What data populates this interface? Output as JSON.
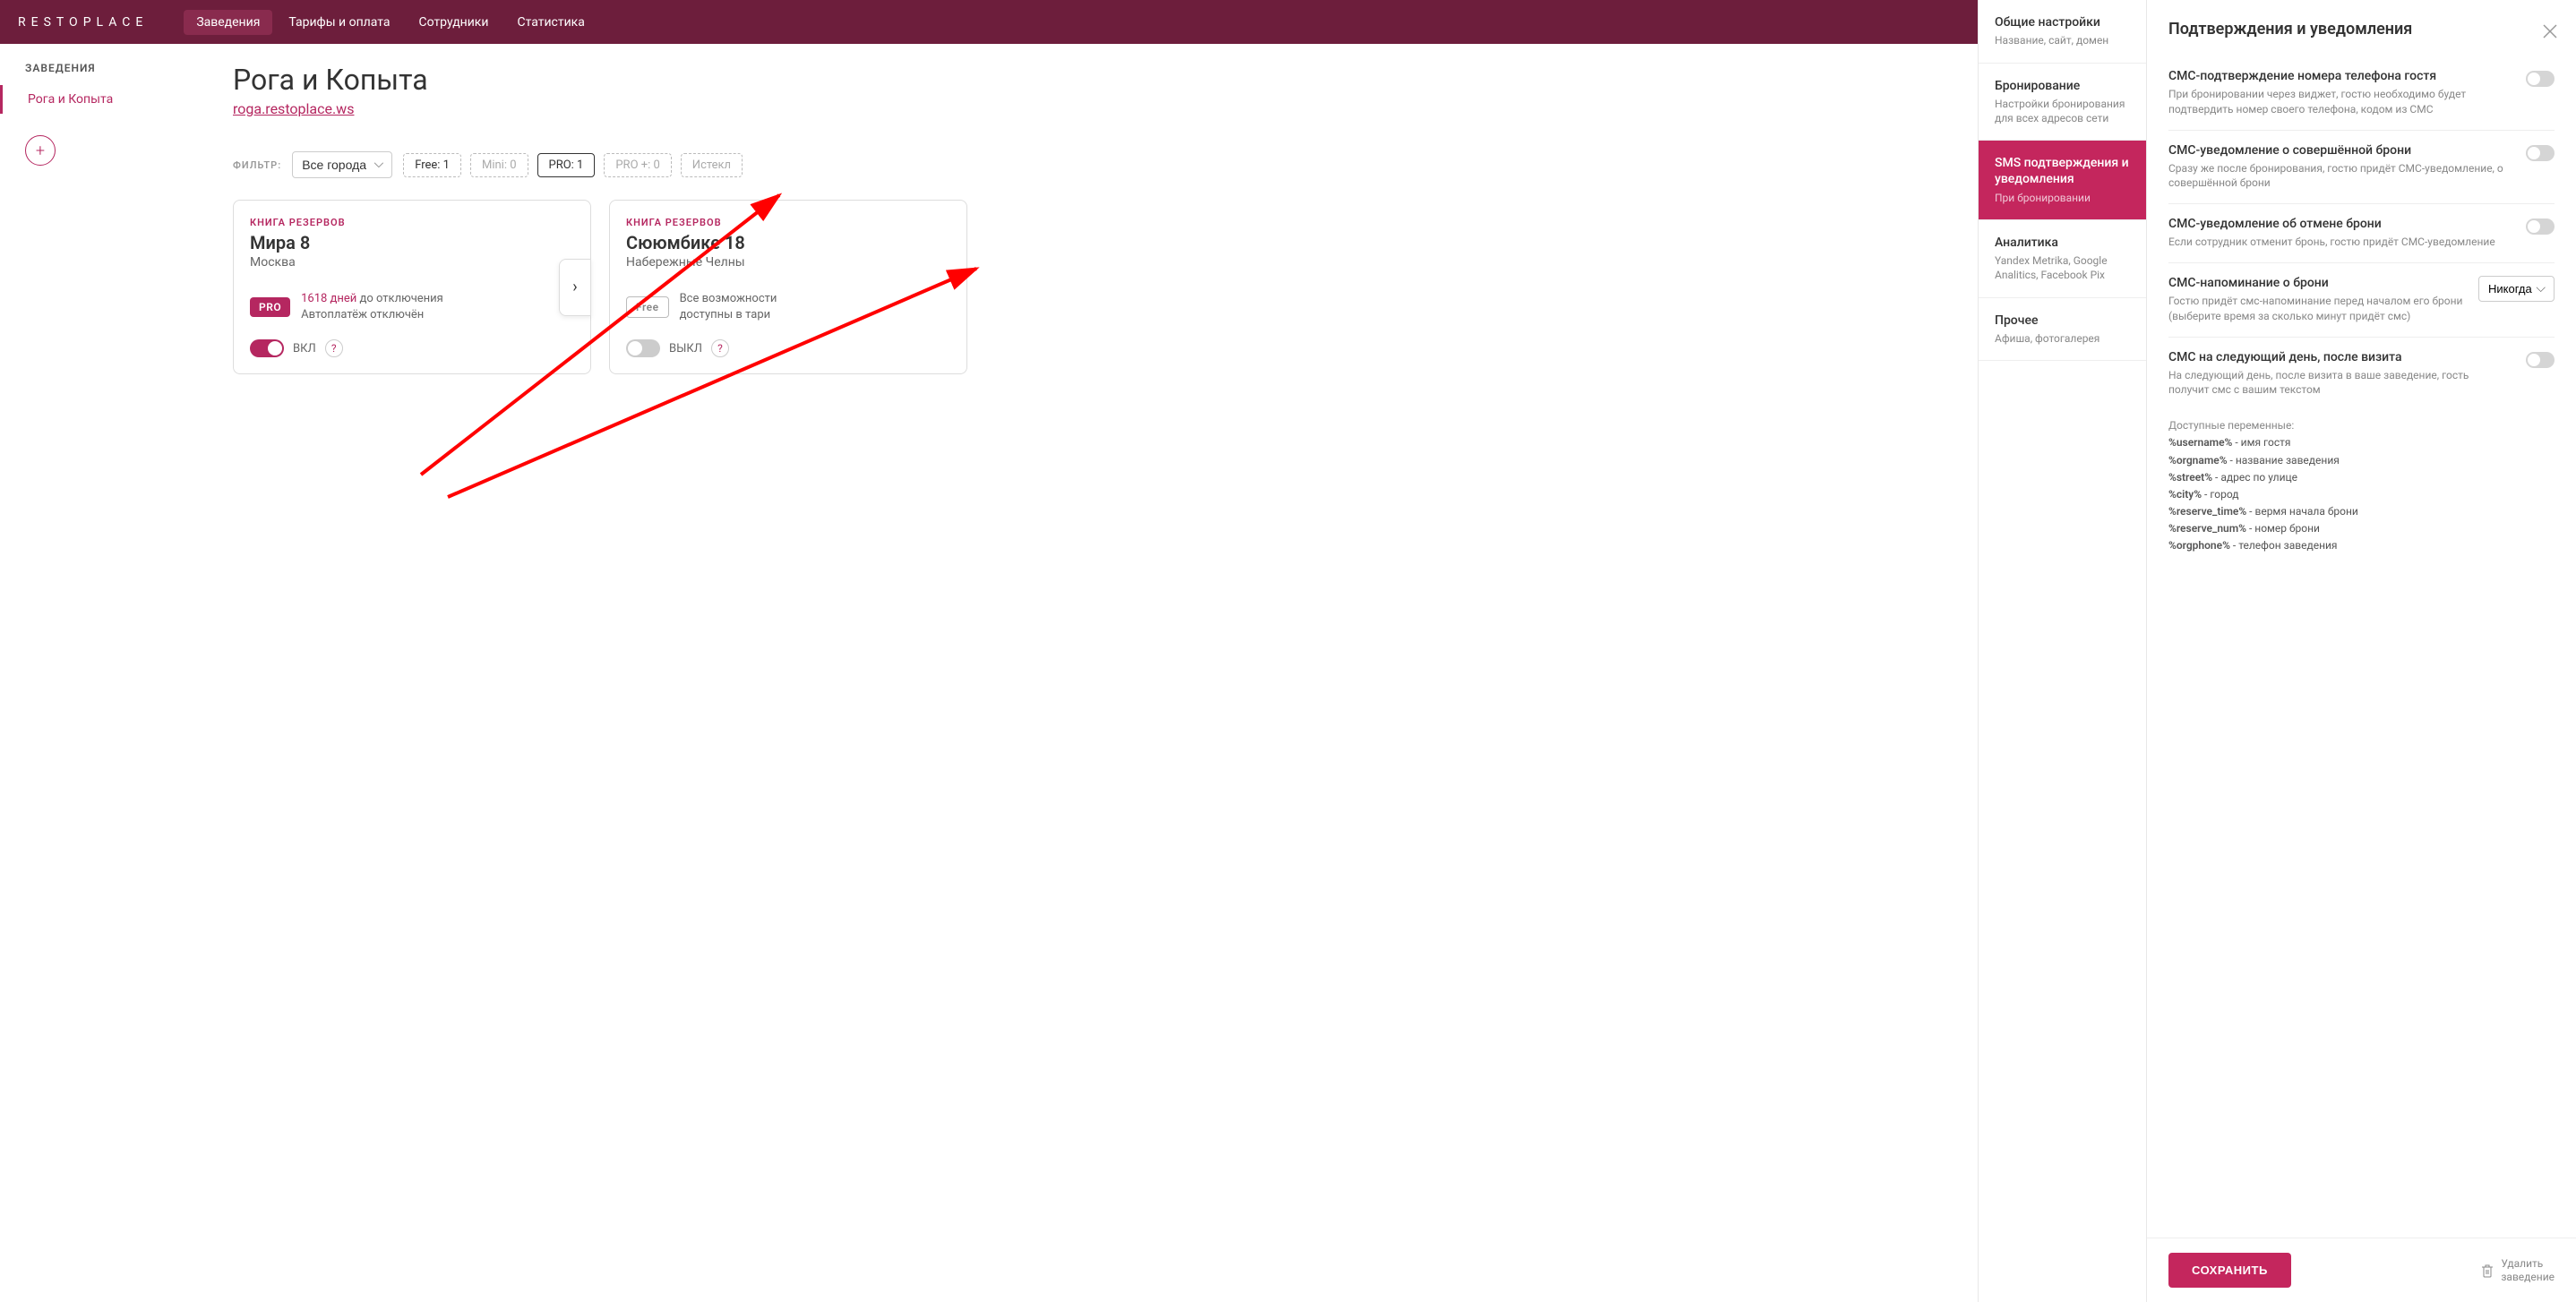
{
  "logo": "RESTOPLACE",
  "nav": {
    "items": [
      "Заведения",
      "Тарифы и оплата",
      "Сотрудники",
      "Статистика"
    ],
    "activeIndex": 0
  },
  "sidebar": {
    "title": "ЗАВЕДЕНИЯ",
    "items": [
      "Рога и Копыта"
    ]
  },
  "page": {
    "title": "Рога и Копыта",
    "url": "roga.restoplace.ws"
  },
  "filter": {
    "label": "ФИЛЬТР:",
    "city": "Все города",
    "tags": [
      {
        "label": "Free: 1",
        "style": "active"
      },
      {
        "label": "Mini: 0",
        "style": ""
      },
      {
        "label": "PRO: 1",
        "style": "solid"
      },
      {
        "label": "PRO +: 0",
        "style": ""
      },
      {
        "label": "Истекл",
        "style": ""
      }
    ]
  },
  "cards": [
    {
      "type": "КНИГА РЕЗЕРВОВ",
      "title": "Мира 8",
      "city": "Москва",
      "badge": "PRO",
      "badgeClass": "",
      "line1a": "1618 дней",
      "line1b": " до отключения",
      "line2": "Автоплатёж отключён",
      "toggleOn": true,
      "toggleLabel": "ВКЛ",
      "hasArrow": true
    },
    {
      "type": "КНИГА РЕЗЕРВОВ",
      "title": "Сююмбике 18",
      "city": "Набережные Челны",
      "badge": "Free",
      "badgeClass": "free",
      "line1a": "",
      "line1b": "Все возможности",
      "line2": "доступны в тари",
      "toggleOn": false,
      "toggleLabel": "ВЫКЛ",
      "hasArrow": false
    }
  ],
  "midPanel": {
    "items": [
      {
        "title": "Общие настройки",
        "sub": "Название, сайт, домен",
        "active": false
      },
      {
        "title": "Бронирование",
        "sub": "Настройки бронирования для всех адресов сети",
        "active": false
      },
      {
        "title": "SMS подтверждения и уведомления",
        "sub": "При бронировании",
        "active": true
      },
      {
        "title": "Аналитика",
        "sub": "Yandex Metrika, Google Analitics, Facebook Pix",
        "active": false
      },
      {
        "title": "Прочее",
        "sub": "Афиша, фотогалерея",
        "active": false
      }
    ]
  },
  "rightPanel": {
    "title": "Подтверждения и уведомления",
    "settings": [
      {
        "title": "СМС-подтверждение номера телефона гостя",
        "desc": "При бронировании через виджет, гостю необходимо будет подтвердить номер своего телефона, кодом из СМС",
        "control": "toggle"
      },
      {
        "title": "СМС-уведомление о совершённой брони",
        "desc": "Сразу же после бронирования, гостю придёт СМС-уведомление, о совершённой брони",
        "control": "toggle"
      },
      {
        "title": "СМС-уведомление об отмене брони",
        "desc": "Если сотрудник отменит бронь, гостю придёт СМС-уведомление",
        "control": "toggle"
      },
      {
        "title": "СМС-напоминание о брони",
        "desc": "Гостю придёт смс-напоминание перед началом его брони (выберите время за сколько минут придёт смс)",
        "control": "select",
        "selectValue": "Никогда"
      },
      {
        "title": "СМС на следующий день, после визита",
        "desc": "На следующий день, после визита в ваше заведение, гость получит смс с вашим текстом",
        "control": "toggle"
      }
    ],
    "varsHeader": "Доступные переменные:",
    "vars": [
      {
        "k": "%username%",
        "v": " - имя гостя"
      },
      {
        "k": "%orgname%",
        "v": " - название заведения"
      },
      {
        "k": "%street%",
        "v": " - адрес по улице"
      },
      {
        "k": "%city%",
        "v": " - город"
      },
      {
        "k": "%reserve_time%",
        "v": " - вермя начала брони"
      },
      {
        "k": "%reserve_num%",
        "v": " - номер брони"
      },
      {
        "k": "%orgphone%",
        "v": " - телефон заведения"
      }
    ],
    "saveLabel": "СОХРАНИТЬ",
    "deleteLabel": "Удалить\nзаведение"
  }
}
